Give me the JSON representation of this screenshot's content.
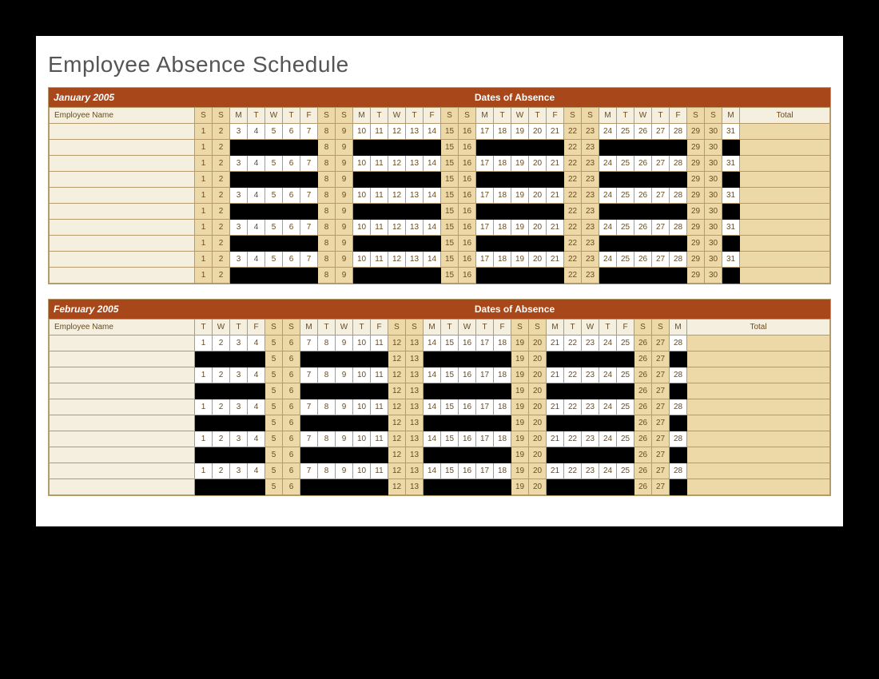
{
  "title": "Employee Absence Schedule",
  "header_dates_of_absence": "Dates of Absence",
  "header_employee_name": "Employee Name",
  "header_total": "Total",
  "months": [
    {
      "label": "January 2005",
      "day_letters": [
        "S",
        "S",
        "M",
        "T",
        "W",
        "T",
        "F",
        "S",
        "S",
        "M",
        "T",
        "W",
        "T",
        "F",
        "S",
        "S",
        "M",
        "T",
        "W",
        "T",
        "F",
        "S",
        "S",
        "M",
        "T",
        "W",
        "T",
        "F",
        "S",
        "S",
        "M"
      ],
      "weekend_flags": [
        1,
        1,
        0,
        0,
        0,
        0,
        0,
        1,
        1,
        0,
        0,
        0,
        0,
        0,
        1,
        1,
        0,
        0,
        0,
        0,
        0,
        1,
        1,
        0,
        0,
        0,
        0,
        0,
        1,
        1,
        0
      ],
      "num_days": 31,
      "row_count": 10
    },
    {
      "label": "February 2005",
      "day_letters": [
        "T",
        "W",
        "T",
        "F",
        "S",
        "S",
        "M",
        "T",
        "W",
        "T",
        "F",
        "S",
        "S",
        "M",
        "T",
        "W",
        "T",
        "F",
        "S",
        "S",
        "M",
        "T",
        "W",
        "T",
        "F",
        "S",
        "S",
        "M"
      ],
      "weekend_flags": [
        0,
        0,
        0,
        0,
        1,
        1,
        0,
        0,
        0,
        0,
        0,
        1,
        1,
        0,
        0,
        0,
        0,
        0,
        1,
        1,
        0,
        0,
        0,
        0,
        0,
        1,
        1,
        0
      ],
      "num_days": 28,
      "row_count": 10
    }
  ]
}
